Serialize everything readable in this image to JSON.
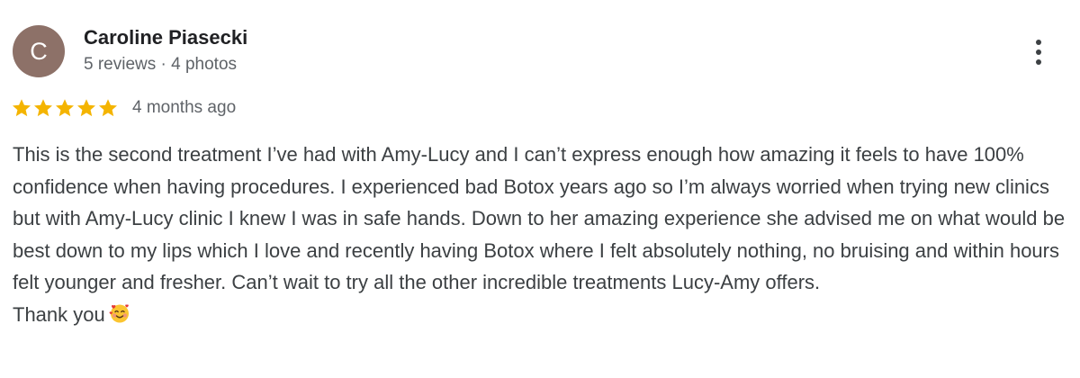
{
  "review": {
    "author": {
      "initial": "C",
      "name": "Caroline Piasecki",
      "meta": "5 reviews · 4 photos"
    },
    "rating": {
      "stars": 5,
      "max": 5,
      "star_color": "#f4b400"
    },
    "date": "4 months ago",
    "body": "This is the second treatment I’ve had with Amy-Lucy and I can’t express enough how amazing it feels to have 100% confidence when having procedures. I experienced bad Botox years ago so I’m always worried when trying new clinics but with Amy-Lucy clinic I knew I was in safe hands. Down to her amazing experience she advised me on what would be best down to my lips which I love and recently having Botox where I felt absolutely nothing, no bruising and within hours felt younger and fresher. Can’t wait to try all the other incredible treatments Lucy-Amy offers.",
    "closing": "Thank you",
    "closing_emoji": "smiling-face-with-hearts-icon"
  },
  "colors": {
    "avatar_bg": "#8d7168",
    "text_primary": "#202124",
    "text_secondary": "#5f6368",
    "body_text": "#3c4043"
  }
}
